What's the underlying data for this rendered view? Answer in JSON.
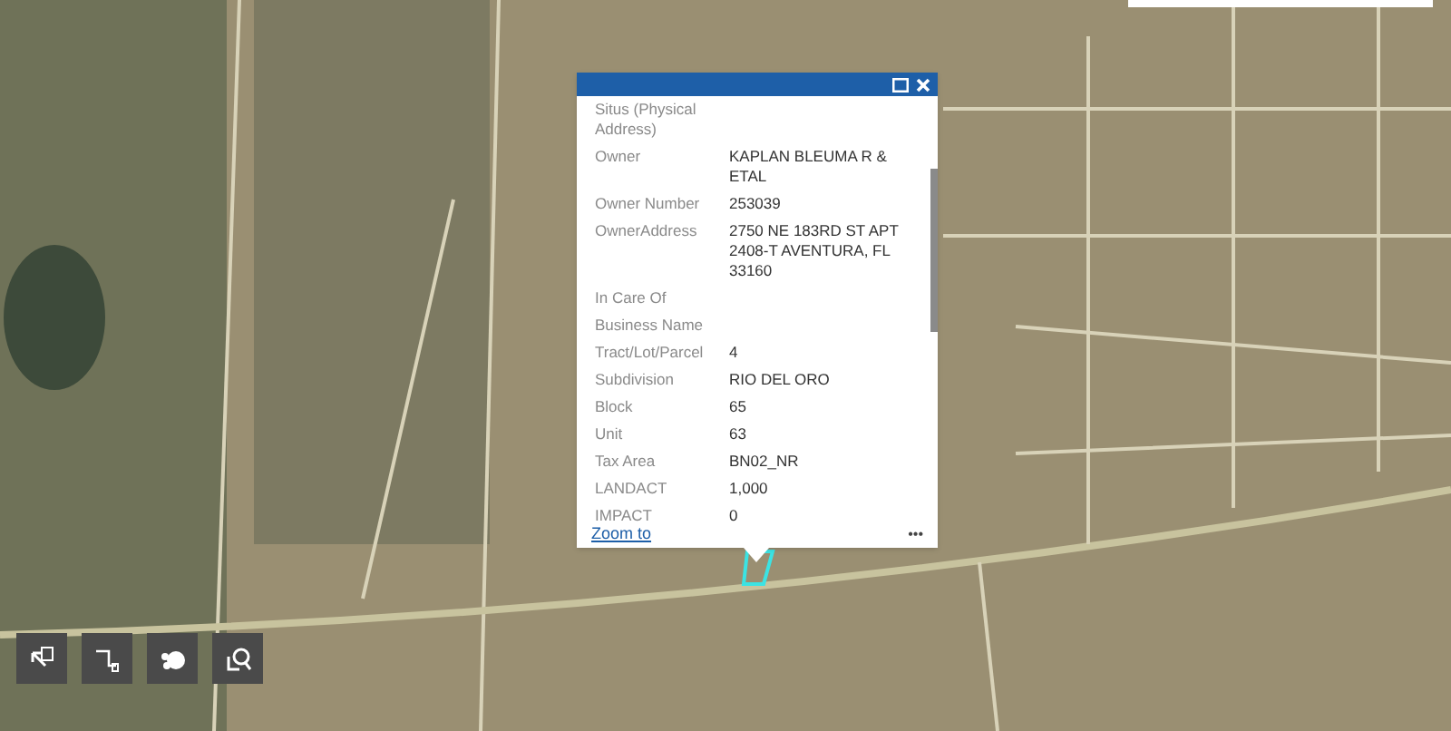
{
  "popup": {
    "fields": [
      {
        "label": "Situs (Physical Address)"
      },
      {
        "label": "Owner",
        "value": "KAPLAN BLEUMA R & ETAL"
      },
      {
        "label": "Owner Number",
        "value": "253039"
      },
      {
        "label": "OwnerAddress",
        "value": "2750 NE 183RD ST APT 2408-T AVENTURA, FL 33160"
      },
      {
        "label": "In Care Of"
      },
      {
        "label": "Business Name"
      },
      {
        "label": "Tract/Lot/Parcel",
        "value": "4"
      },
      {
        "label": "Subdivision",
        "value": "RIO DEL ORO"
      },
      {
        "label": "Block",
        "value": "65"
      },
      {
        "label": "Unit",
        "value": "63"
      },
      {
        "label": "Tax Area",
        "value": "BN02_NR"
      },
      {
        "label": "LANDACT",
        "value": "1,000"
      },
      {
        "label": "IMPACT",
        "value": "0"
      }
    ],
    "zoom_link": "Zoom to",
    "more": "•••"
  },
  "toolbar": [
    {
      "kind": "select"
    },
    {
      "kind": "measure"
    },
    {
      "kind": "layers"
    },
    {
      "kind": "zoom"
    }
  ]
}
